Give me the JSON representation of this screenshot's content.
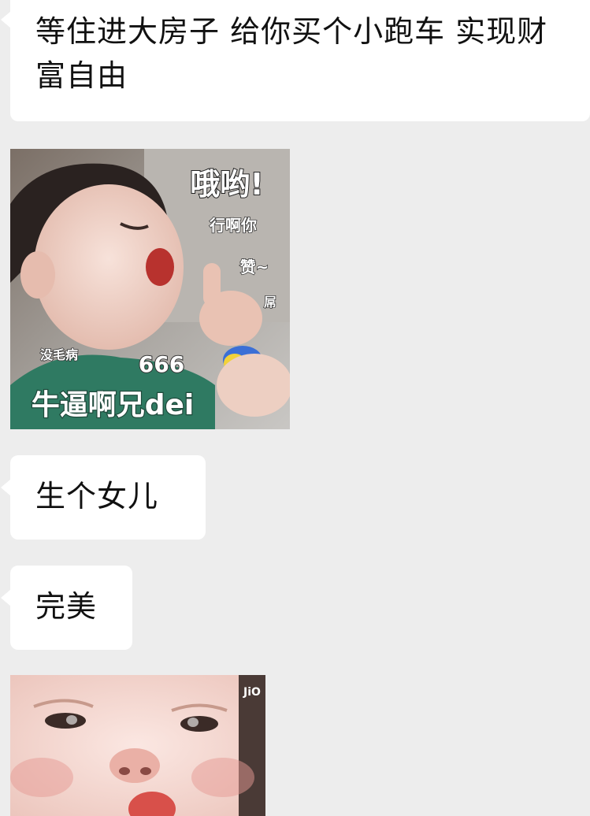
{
  "messages": [
    {
      "type": "text",
      "text": "等住进大房子 给你买个小跑车 实现财富自由"
    },
    {
      "type": "sticker",
      "captions": {
        "headline": "哦哟!",
        "line1": "行啊你",
        "line2": "赞~",
        "line3": "屌",
        "side": "没毛病",
        "number": "666",
        "bottom": "牛逼啊兄dei"
      }
    },
    {
      "type": "text",
      "text": "生个女儿"
    },
    {
      "type": "text",
      "text": "完美"
    },
    {
      "type": "sticker",
      "captions": {
        "watermark": "JiO"
      }
    }
  ],
  "colors": {
    "background": "#ededed",
    "bubble": "#ffffff",
    "text": "#111111"
  }
}
